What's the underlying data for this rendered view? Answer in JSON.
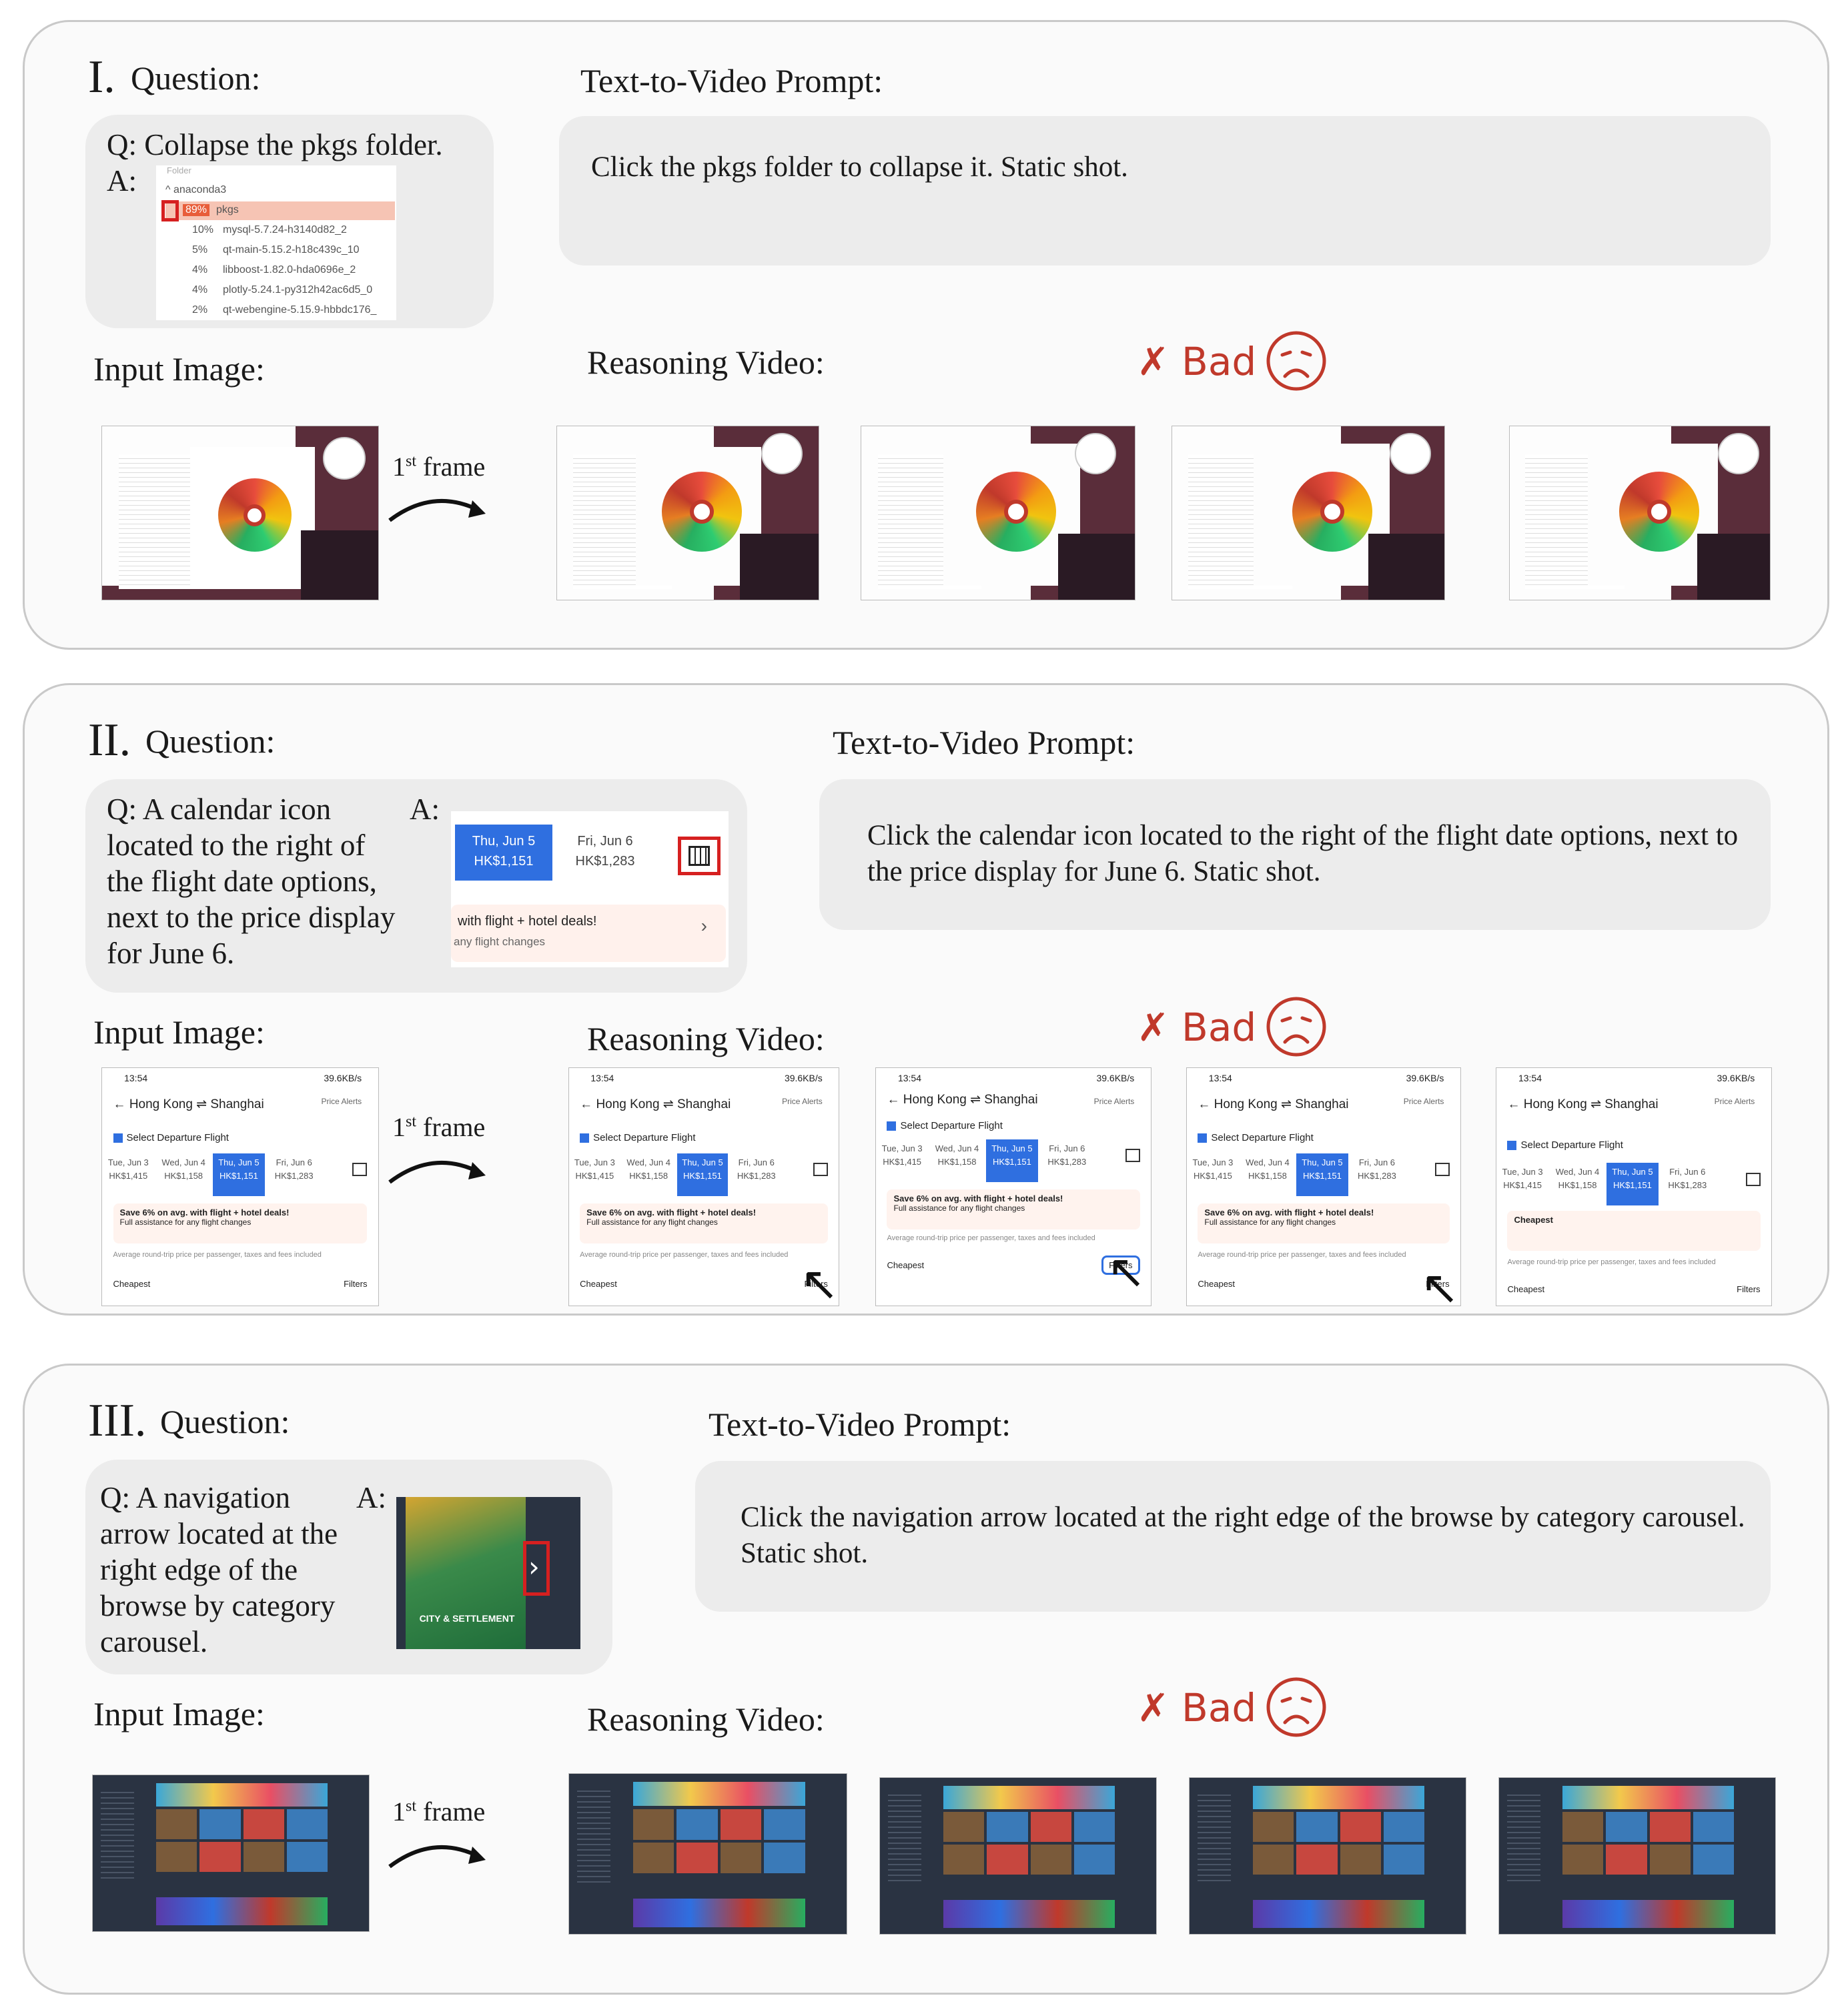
{
  "panels": [
    {
      "numeral": "I.",
      "question_label": "Question:",
      "question": "Q: Collapse the pkgs folder.",
      "answer_label": "A:",
      "answer_crop": {
        "folder_header": "Folder",
        "parent": "anaconda3",
        "rows": [
          {
            "pct": "89%",
            "name": "pkgs"
          },
          {
            "pct": "10%",
            "name": "mysql-5.7.24-h3140d82_2"
          },
          {
            "pct": "5%",
            "name": "qt-main-5.15.2-h18c439c_10"
          },
          {
            "pct": "4%",
            "name": "libboost-1.82.0-hda0696e_2"
          },
          {
            "pct": "4%",
            "name": "plotly-5.24.1-py312h42ac6d5_0"
          },
          {
            "pct": "2%",
            "name": "qt-webengine-5.15.9-hbbdc176_"
          }
        ]
      },
      "prompt_label": "Text-to-Video Prompt:",
      "prompt": "Click the pkgs folder to collapse it. Static shot.",
      "input_label": "Input Image:",
      "video_label": "Reasoning Video:",
      "first_frame": "1",
      "first_frame_sup": "st",
      "first_frame_word": "frame",
      "verdict": "✗ Bad"
    },
    {
      "numeral": "II.",
      "question_label": "Question:",
      "question": "Q: A calendar icon located to the right of the flight date options, next to the price display for June 6.",
      "answer_label": "A:",
      "answer_crop": {
        "date1_day": "Thu, Jun 5",
        "date1_price": "HK$1,151",
        "date2_day": "Fri, Jun 6",
        "date2_price": "HK$1,283",
        "promo": "with flight + hotel deals!",
        "promo_sub": "any flight changes"
      },
      "prompt_label": "Text-to-Video Prompt:",
      "prompt": "Click the calendar icon located to the right of the flight date options, next to the price display for June 6. Static shot.",
      "input_label": "Input Image:",
      "video_label": "Reasoning Video:",
      "first_frame": "1",
      "first_frame_sup": "st",
      "first_frame_word": "frame",
      "verdict": "✗ Bad",
      "screen": {
        "time": "13:54",
        "net": "39.6KB/s",
        "route": "Hong Kong ⇌ Shanghai",
        "alerts": "Price Alerts",
        "select": "Select Departure Flight",
        "dates": [
          {
            "day": "Tue, Jun 3",
            "price": "HK$1,415"
          },
          {
            "day": "Wed, Jun 4",
            "price": "HK$1,158"
          },
          {
            "day": "Thu, Jun 5",
            "price": "HK$1,151"
          },
          {
            "day": "Fri, Jun 6",
            "price": "HK$1,283"
          }
        ],
        "promo": "Save 6% on avg. with flight + hotel deals!",
        "promo_sub": "Full assistance for any flight changes",
        "avg": "Average round-trip price per passenger, taxes and fees included",
        "cheapest": "Cheapest",
        "filters": "Filters"
      }
    },
    {
      "numeral": "III.",
      "question_label": "Question:",
      "question": "Q: A navigation arrow located at the right edge of the browse by category carousel.",
      "answer_label": "A:",
      "answer_crop": {
        "tile_label": "CITY & SETTLEMENT"
      },
      "prompt_label": "Text-to-Video Prompt:",
      "prompt": "Click the navigation arrow located at the right edge of the browse by category carousel. Static shot.",
      "input_label": "Input Image:",
      "video_label": "Reasoning Video:",
      "first_frame": "1",
      "first_frame_sup": "st",
      "first_frame_word": "frame",
      "verdict": "✗ Bad"
    }
  ],
  "icons": {
    "sad_face": "frowning-face-icon",
    "cursor": "mouse-pointer-icon",
    "arrow": "curved-arrow-icon"
  },
  "colors": {
    "bad": "#c0392b",
    "highlight": "#d62020",
    "accent_blue": "#2f6fe0"
  }
}
